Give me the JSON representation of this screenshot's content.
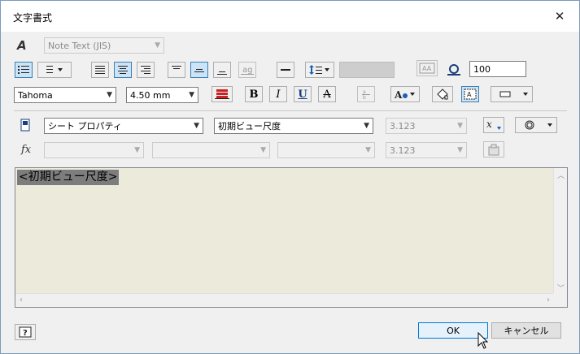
{
  "dialog": {
    "title": "文字書式",
    "close_glyph": "✕"
  },
  "style": {
    "value": "Note Text (JIS)"
  },
  "zoom": {
    "value": "100"
  },
  "font": {
    "family": "Tahoma",
    "size": "4.50 mm"
  },
  "format_buttons": {
    "bold": "B",
    "italic": "I",
    "underline": "U",
    "strike": "A"
  },
  "parameters": {
    "source": "シート プロパティ",
    "property": "初期ビュー尺度",
    "precision": "3.123"
  },
  "function_row": {
    "label": "fx",
    "precision": "3.123"
  },
  "editor": {
    "text": "<初期ビュー尺度>"
  },
  "footer": {
    "ok": "OK",
    "cancel": "キャンセル",
    "help": "?"
  },
  "colors": {
    "editor_bg": "#eceadb",
    "selected_bg": "#cce4f7"
  }
}
